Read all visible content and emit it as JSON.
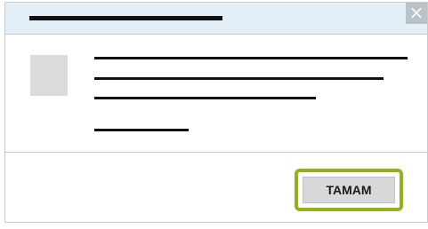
{
  "dialog": {
    "close_glyph": "×",
    "ok_label": "TAMAM",
    "colors": {
      "titlebar_bg": "#e3eff6",
      "close_bg": "#b9c2c7",
      "highlight": "#8fb31d",
      "button_bg": "#d6d8d9",
      "placeholder_icon": "#d9dbdc"
    },
    "icons": {
      "close": "close-icon",
      "message": "message-icon"
    }
  }
}
